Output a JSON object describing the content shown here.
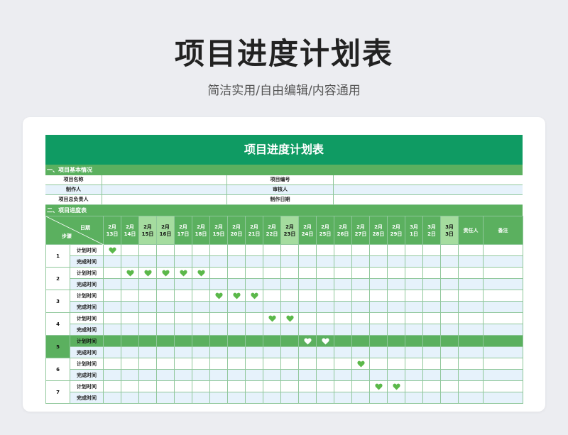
{
  "hero": {
    "title": "项目进度计划表",
    "subtitle": "简洁实用/自由编辑/内容通用"
  },
  "sheet": {
    "title": "项目进度计划表",
    "section1": "一、项目基本情况",
    "info": [
      {
        "label1": "项目名称",
        "value1": "",
        "label2": "项目编号",
        "value2": ""
      },
      {
        "label1": "制作人",
        "value1": "",
        "label2": "审核人",
        "value2": ""
      },
      {
        "label1": "项目总负责人",
        "value1": "",
        "label2": "制作日期",
        "value2": ""
      }
    ],
    "section2": "二、项目进度表",
    "corner": {
      "date": "日期",
      "step": "步骤"
    },
    "dates": [
      {
        "m": "2月",
        "d": "13日",
        "hl": false
      },
      {
        "m": "2月",
        "d": "14日",
        "hl": false
      },
      {
        "m": "2月",
        "d": "15日",
        "hl": true
      },
      {
        "m": "2月",
        "d": "16日",
        "hl": true
      },
      {
        "m": "2月",
        "d": "17日",
        "hl": false
      },
      {
        "m": "2月",
        "d": "18日",
        "hl": false
      },
      {
        "m": "2月",
        "d": "19日",
        "hl": false
      },
      {
        "m": "2月",
        "d": "20日",
        "hl": false
      },
      {
        "m": "2月",
        "d": "21日",
        "hl": false
      },
      {
        "m": "2月",
        "d": "22日",
        "hl": false
      },
      {
        "m": "2月",
        "d": "23日",
        "hl": true
      },
      {
        "m": "2月",
        "d": "24日",
        "hl": false
      },
      {
        "m": "2月",
        "d": "25日",
        "hl": false
      },
      {
        "m": "2月",
        "d": "26日",
        "hl": false
      },
      {
        "m": "2月",
        "d": "27日",
        "hl": false
      },
      {
        "m": "2月",
        "d": "28日",
        "hl": false
      },
      {
        "m": "2月",
        "d": "29日",
        "hl": false
      },
      {
        "m": "3月",
        "d": "1日",
        "hl": false
      },
      {
        "m": "3月",
        "d": "2日",
        "hl": false
      },
      {
        "m": "3月",
        "d": "3日",
        "hl": true
      }
    ],
    "owner_header": "责任人",
    "note_header": "备注",
    "plan_label": "计划时间",
    "done_label": "完成时间",
    "steps": [
      {
        "num": "1",
        "plan_marks": [
          0
        ],
        "dark": false
      },
      {
        "num": "2",
        "plan_marks": [
          1,
          2,
          3,
          4,
          5
        ],
        "dark": false
      },
      {
        "num": "3",
        "plan_marks": [
          6,
          7,
          8
        ],
        "dark": false
      },
      {
        "num": "4",
        "plan_marks": [
          9,
          10
        ],
        "dark": false
      },
      {
        "num": "5",
        "plan_marks": [
          11,
          12
        ],
        "dark": true
      },
      {
        "num": "6",
        "plan_marks": [
          14
        ],
        "dark": false
      },
      {
        "num": "7",
        "plan_marks": [
          15,
          16
        ],
        "dark": false
      }
    ],
    "colors": {
      "heart_green": "#5bb84a",
      "heart_white": "#ffffff",
      "header_green": "#0f9b63",
      "section_green": "#5bb05f"
    }
  }
}
